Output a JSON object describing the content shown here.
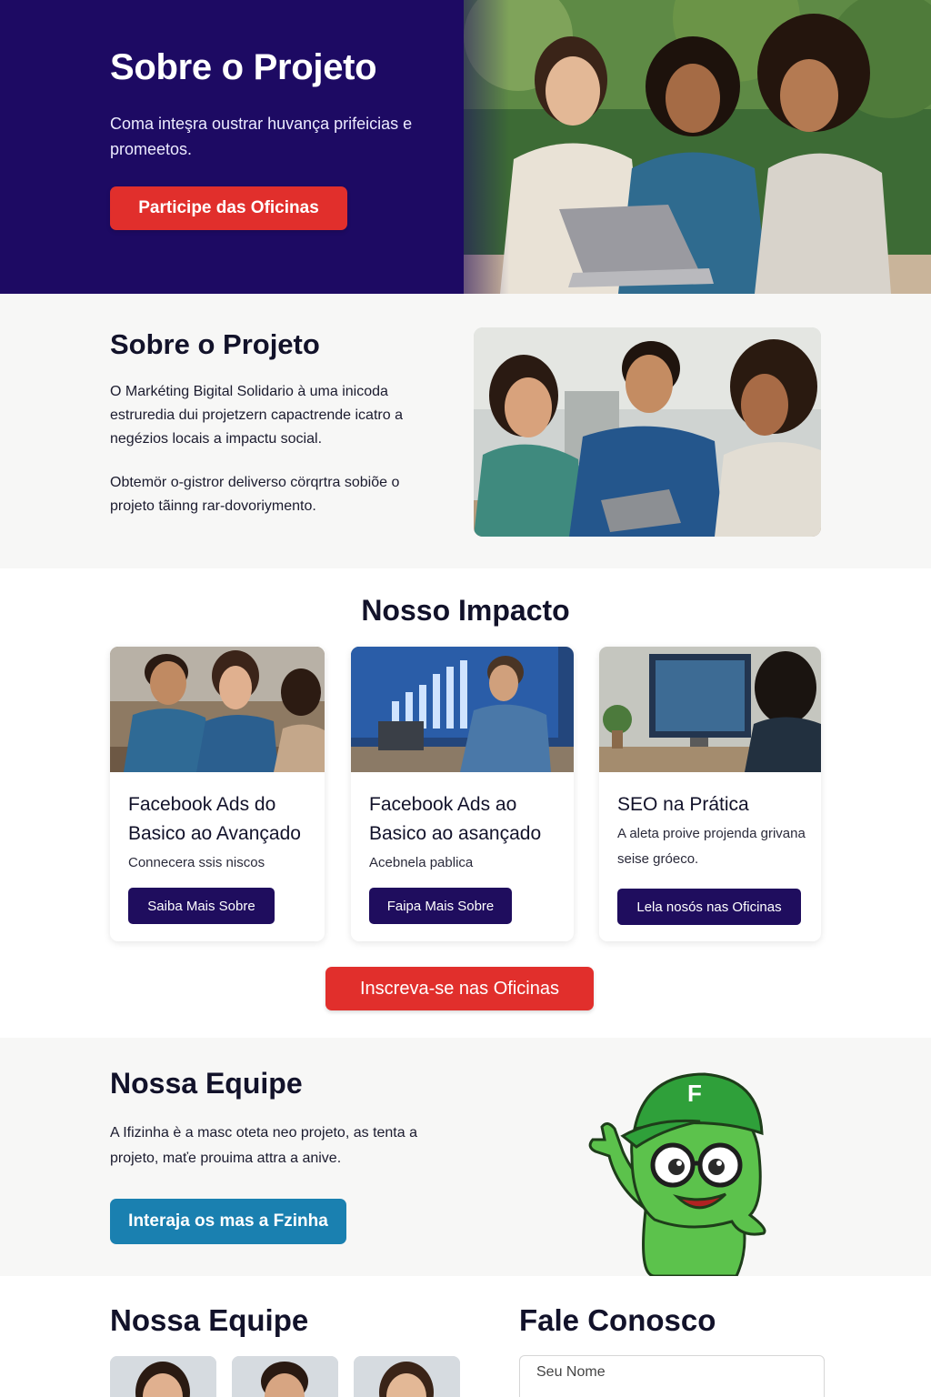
{
  "hero": {
    "title": "Sobre o Projeto",
    "subtitle": "Coma inteşra oustrar huvança prifeicias e promeetos.",
    "cta_label": "Participe das Oficinas"
  },
  "about": {
    "title": "Sobre o Projeto",
    "paragraph1": "O Markéting Bigital Solidario à uma inicoda estruredia dui projetzern capactrende icatro a negézios locais a impactu social.",
    "paragraph2": "Obtemör o-gistror deliverso cörqrtra sobiõe o projeto tãinng rar-dovoriymento."
  },
  "impact": {
    "title": "Nosso Impacto",
    "cards": [
      {
        "title": "Facebook Ads do Basico ao Avançado",
        "description": "Connecera ssis niscos",
        "button": "Saiba Mais Sobre"
      },
      {
        "title": "Facebook Ads ao Basico ao asançado",
        "description": "Acebnela pablica",
        "button": "Faipa Mais Sobre"
      },
      {
        "title": "SEO na Prática",
        "description": "A aleta proive projenda grivana seise gróeco.",
        "button": "Lela nosós nas Oficinas"
      }
    ],
    "cta_label": "Inscreva-se nas Oficinas"
  },
  "mascot_section": {
    "title": "Nossa Equipe",
    "description": "A Ifizinha è a masc oteta neo projeto, as tenta a projeto, maťe prouima attra a anive.",
    "button": "Interaja os mas a Fzinha",
    "cap_letter": "F"
  },
  "team": {
    "title": "Nossa Equipe"
  },
  "contact": {
    "title": "Fale Conosco",
    "name_placeholder": "Seu Nome"
  },
  "colors": {
    "hero_bg": "#1d0a63",
    "accent_red": "#e12f2c",
    "navy_button": "#1f0d5e",
    "teal_button": "#1a80b0",
    "mascot_green": "#5cc24c"
  }
}
